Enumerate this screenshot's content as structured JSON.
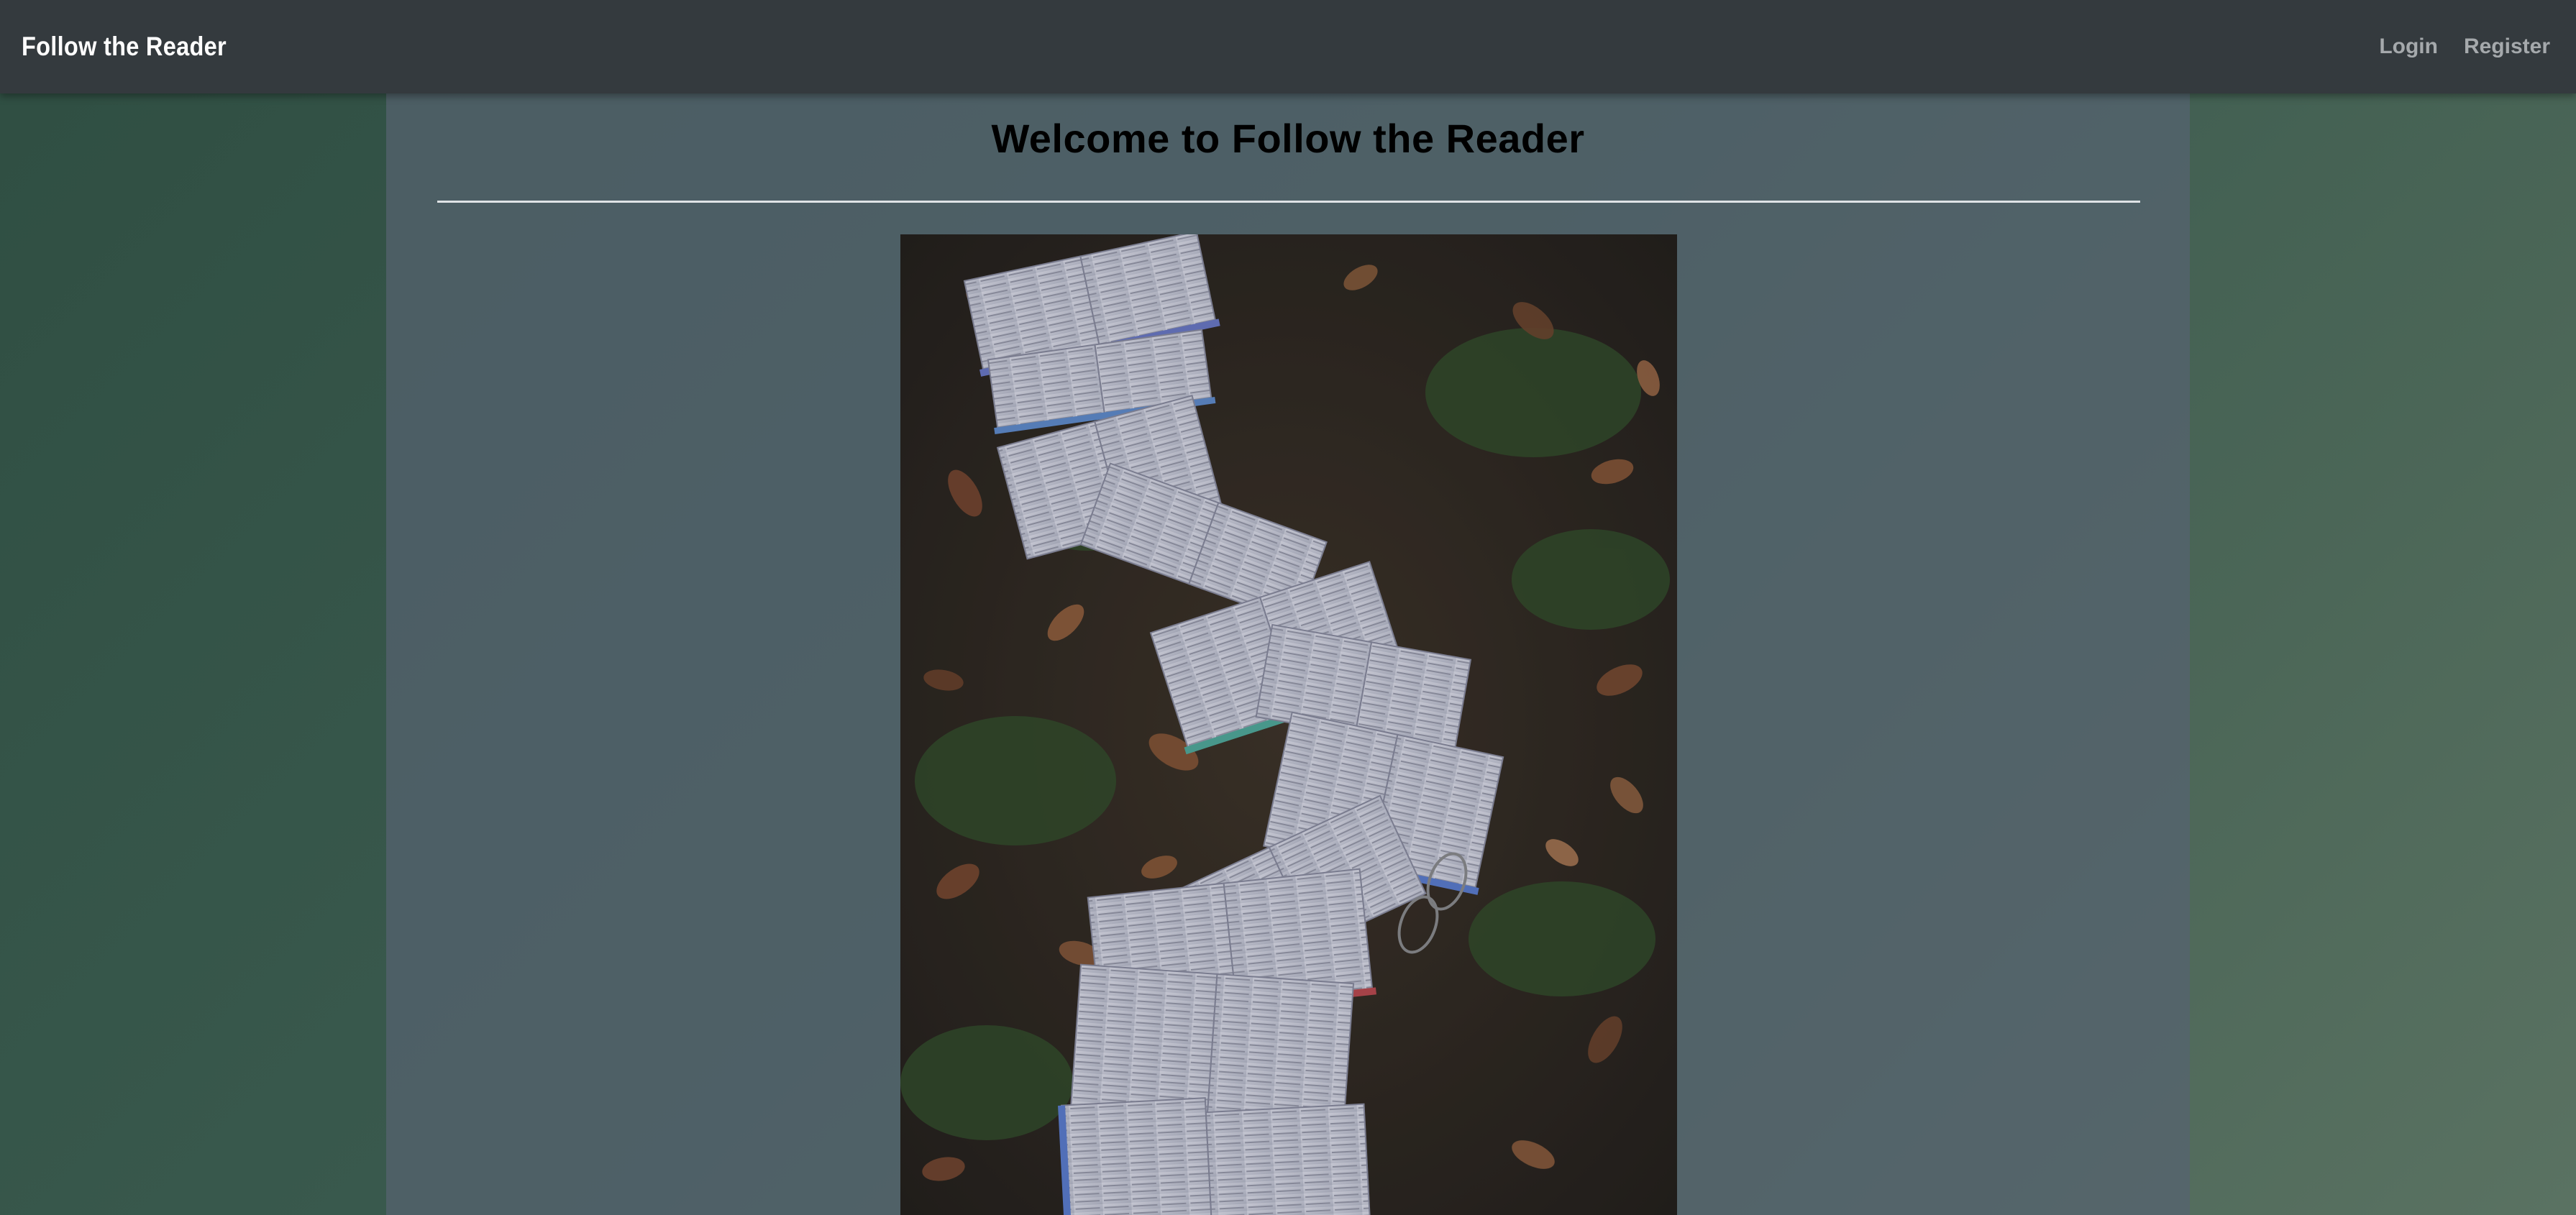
{
  "navbar": {
    "brand": "Follow the Reader",
    "links": {
      "login": "Login",
      "register": "Register"
    },
    "background_color": "#343a3e"
  },
  "main": {
    "title": "Welcome to Follow the Reader",
    "hero_image": {
      "subject": "open-books-on-autumn-leaves"
    }
  },
  "colors": {
    "background_gradient_start": "#2f4e42",
    "background_gradient_end": "#5a7262",
    "panel": "#566270",
    "link": "#a5a9ac"
  }
}
